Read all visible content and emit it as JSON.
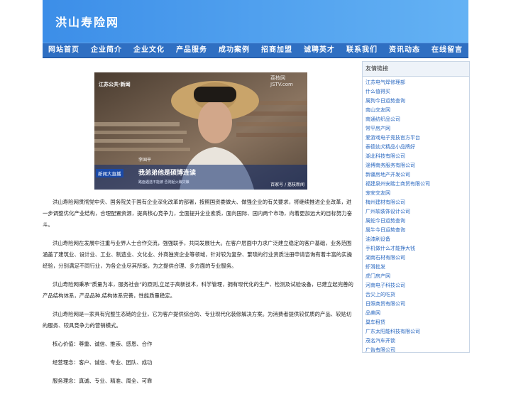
{
  "site": {
    "title": "洪山寿险网"
  },
  "nav": [
    "网站首页",
    "企业简介",
    "企业文化",
    "产品服务",
    "成功案例",
    "招商加盟",
    "诚聘英才",
    "联系我们",
    "资讯动态",
    "在线留言"
  ],
  "photo": {
    "channel_logo": "江苏公共·新闻",
    "watermark": "荔枝网 JSTV.com",
    "name_tag": "李国平",
    "caption_strip": "新闻大直播",
    "subtitle": "我弟弟他是硕博连读",
    "ticker": "路面遇选不能被 否则起火酿灾酿",
    "credit": "百家号 / 荔枝新闻"
  },
  "paragraphs": [
    "洪山寿险网贯彻党中央、国务院关于国有企业深化改革的部署，按照国资委做大、做强企业的有关要求，将继续推进企业改革，进一步调整优化产业结构，合理配置资源，提高核心竞争力，全面提升企业素质，面向国际、国内两个市场，向着更加远大的目标努力奋斗。",
    "洪山寿险网在发展中注重与业界人士合作交流，强强联手，共同发展壮大。在客户层面中力求广泛建立稳定的客户基础，业务范围涵盖了建筑业、设计业、工业、制造业、文化业、外商独资企业等领域，针对较为复杂、繁琐的行业资质注册申请咨询有着丰富的实操经验，分别满足不同行业，为各企业尽其所能，为之提供合理、多方面的专业服务。",
    "洪山寿险网秉承“质量为本，服务社会”的原则,立足于高新技术，科学管理，拥有现代化的生产、检测及试验设备，已建立起完善的产品结构体系，产品品种,结构体系完善，性能质量稳定。",
    "洪山寿险网是一家具有完整生态链的企业，它为客户提供综合的、专业现代化装修解决方案。为消费者提供较优质的产品、较贴切的服务、较具竞争力的营销模式。",
    "核心价值：尊重、诚信、推崇、感恩、合作",
    "经营理念：客户、诚信、专业、团队、成功",
    "服务理念：真诚、专业、精准、周全、可靠"
  ],
  "sidebar": {
    "title": "友情链接",
    "links": [
      "江苏电气焊修理部",
      "什么值得买",
      "属狗今日运势查询",
      "南山交友网",
      "南通纺织品公司",
      "常平房产网",
      "爱游戏电子竞技官方平台",
      "泰德幼犬精品小品牌好",
      "湖北科技有限公司",
      "淄博南务服务有限公司",
      "新疆房地产开发公司",
      "福建泉州安踏士商贸有限公司",
      "宠安交友网",
      "梅州建材有限公司",
      "广州软装饰设计公司",
      "属蛇今日运势查询",
      "属牛今日运势查询",
      "油漆刷设备",
      "手机做什么才能挣大钱",
      "湖南石材有限公司",
      "虾滑批发",
      "虎门房产网",
      "河南电子科技公司",
      "舌尖上的吃货",
      "日照商贸有限公司",
      "品美网",
      "巢车租赁",
      "广东太阳能科技有限公司",
      "茂名汽车开锁",
      "广告有限公司"
    ]
  }
}
